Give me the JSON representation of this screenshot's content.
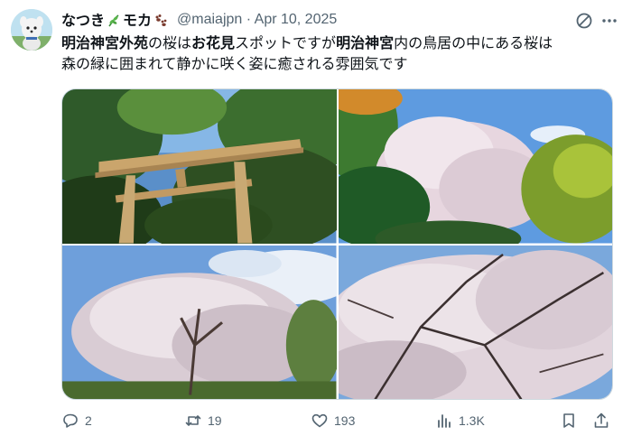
{
  "post": {
    "display_name_part1": "なつき",
    "display_name_part2": "モカ",
    "handle_and_date": "@maiajpn · Apr 10, 2025",
    "text_segments": [
      {
        "t": "明治神宮外苑",
        "bold": true
      },
      {
        "t": "の桜は",
        "bold": false
      },
      {
        "t": "お花見",
        "bold": true
      },
      {
        "t": "スポットですが",
        "bold": false
      },
      {
        "t": "明治神宮",
        "bold": true
      },
      {
        "t": "内の鳥居の中にある桜は\n森の緑に囲まれて静かに咲く姿に癒される雰囲気です",
        "bold": false
      }
    ]
  },
  "icons": {
    "avatar": "avatar-photo",
    "name_emoji_1": "herb-icon",
    "name_emoji_2": "paw-prints-icon",
    "grok": "grok-icon",
    "more": "more-icon",
    "reply": "reply-icon",
    "repost": "repost-icon",
    "like": "heart-icon",
    "views": "views-icon",
    "bookmark": "bookmark-icon",
    "share": "share-icon"
  },
  "actions": {
    "replies": "2",
    "reposts": "19",
    "likes": "193",
    "views": "1.3K"
  },
  "colors": {
    "text": "#0f1419",
    "secondary": "#536471",
    "border": "#cfd9de"
  }
}
